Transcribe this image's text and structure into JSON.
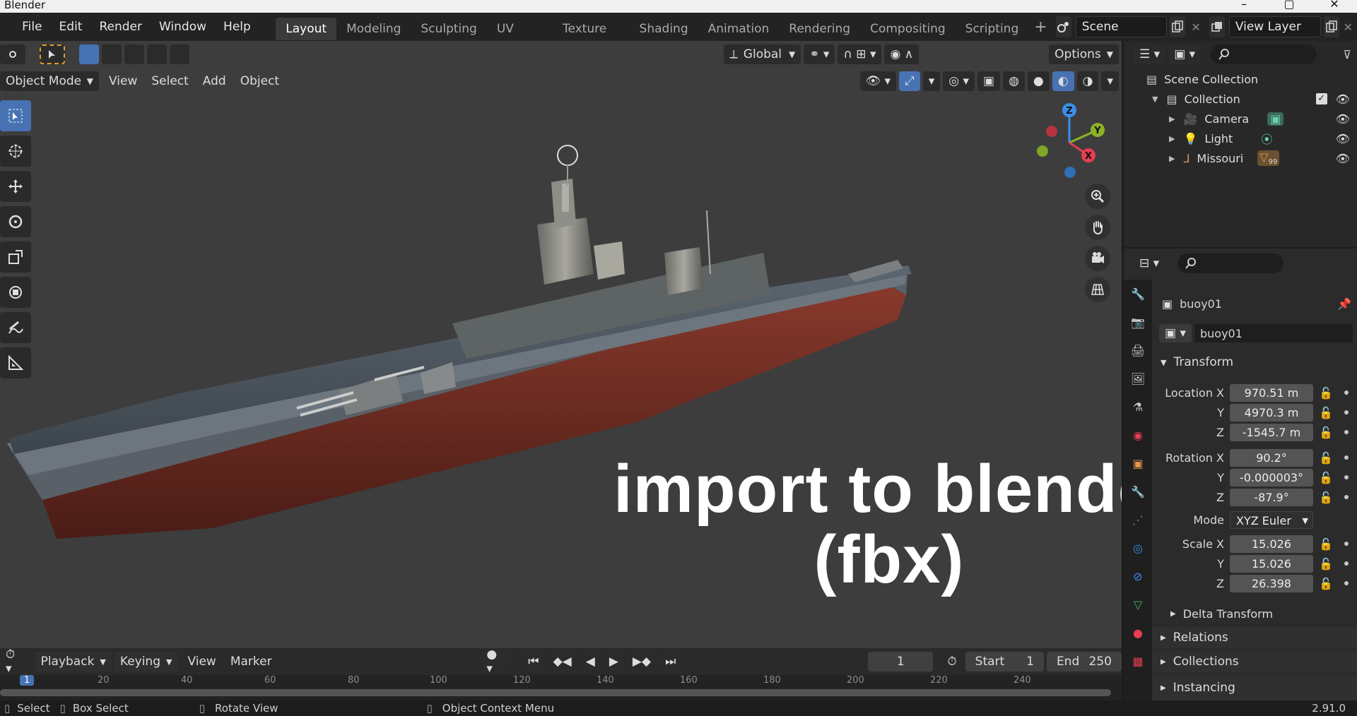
{
  "window": {
    "title": "Blender"
  },
  "menu": {
    "items": [
      "File",
      "Edit",
      "Render",
      "Window",
      "Help"
    ]
  },
  "workspaces": [
    {
      "label": "Layout",
      "active": true
    },
    {
      "label": "Modeling"
    },
    {
      "label": "Sculpting"
    },
    {
      "label": "UV Editing"
    },
    {
      "label": "Texture Paint"
    },
    {
      "label": "Shading"
    },
    {
      "label": "Animation"
    },
    {
      "label": "Rendering"
    },
    {
      "label": "Compositing"
    },
    {
      "label": "Scripting"
    }
  ],
  "scene": {
    "name": "Scene"
  },
  "view_layer": {
    "name": "View Layer"
  },
  "viewport": {
    "transform_orientation": "Global",
    "options_label": "Options",
    "mode": "Object Mode",
    "menus": [
      "View",
      "Select",
      "Add",
      "Object"
    ],
    "overlay_text_line1": "import to blender",
    "overlay_text_line2": "(fbx)",
    "gizmo_labels": {
      "z": "Z",
      "y": "Y",
      "x": "X"
    }
  },
  "outliner": {
    "root": "Scene Collection",
    "collection": "Collection",
    "items": [
      "Camera",
      "Light",
      "Missouri"
    ],
    "missouri_badge": "99"
  },
  "properties": {
    "object_name": "buoy01",
    "data_name": "buoy01",
    "transform_title": "Transform",
    "location": {
      "label": "Location X",
      "x": "970.51 m",
      "y": "4970.3 m",
      "z": "-1545.7 m"
    },
    "rotation": {
      "label": "Rotation X",
      "x": "90.2°",
      "y": "-0.000003°",
      "z": "-87.9°"
    },
    "mode": {
      "label": "Mode",
      "value": "XYZ Euler"
    },
    "scale": {
      "label": "Scale X",
      "x": "15.026",
      "y": "15.026",
      "z": "26.398"
    },
    "axis_labels": {
      "y": "Y",
      "z": "Z"
    },
    "delta_transform": "Delta Transform",
    "relations": "Relations",
    "collections": "Collections",
    "instancing": "Instancing"
  },
  "timeline": {
    "menus": [
      "Playback",
      "Keying",
      "View",
      "Marker"
    ],
    "current_frame": "1",
    "start_label": "Start",
    "start_value": "1",
    "end_label": "End",
    "end_value": "250",
    "ticks": [
      "1",
      "20",
      "40",
      "60",
      "80",
      "100",
      "120",
      "140",
      "160",
      "180",
      "200",
      "220",
      "240"
    ]
  },
  "statusbar": {
    "select": "Select",
    "box_select": "Box Select",
    "rotate_view": "Rotate View",
    "context_menu": "Object Context Menu",
    "version": "2.91.0"
  },
  "colors": {
    "accent": "#4772b3",
    "x_axis": "#e63e52",
    "y_axis": "#8cb228",
    "z_axis": "#3b8eea"
  }
}
